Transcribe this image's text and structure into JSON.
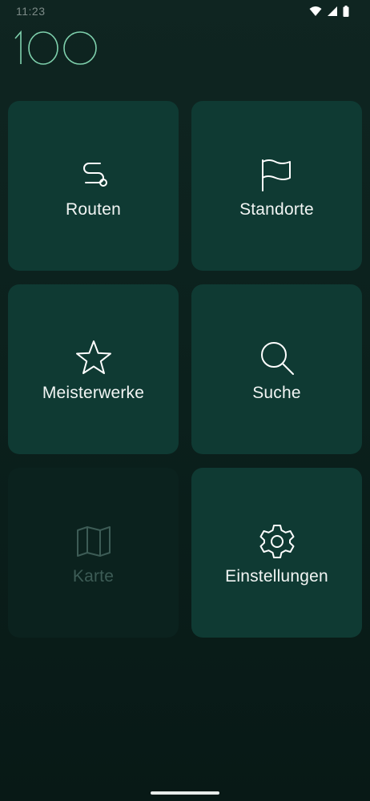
{
  "status_bar": {
    "time": "11:23",
    "icons": [
      "wifi-icon",
      "cellular-icon",
      "battery-icon"
    ]
  },
  "app": {
    "logo_text": "100",
    "accent_color": "#7fd1ad"
  },
  "menu": {
    "tiles": [
      {
        "label": "Routen",
        "icon": "route-icon",
        "enabled": true
      },
      {
        "label": "Standorte",
        "icon": "flag-icon",
        "enabled": true
      },
      {
        "label": "Meisterwerke",
        "icon": "star-icon",
        "enabled": true
      },
      {
        "label": "Suche",
        "icon": "search-icon",
        "enabled": true
      },
      {
        "label": "Karte",
        "icon": "map-icon",
        "enabled": false
      },
      {
        "label": "Einstellungen",
        "icon": "gear-icon",
        "enabled": true
      }
    ]
  },
  "colors": {
    "background": "#0c221e",
    "tile": "#0f3a33",
    "tile_disabled": "#0b221e",
    "label": "#f2f5f4",
    "label_disabled": "#3d5c56"
  }
}
